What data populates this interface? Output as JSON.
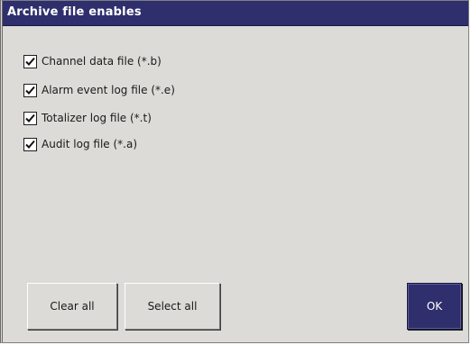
{
  "dialog": {
    "title": "Archive file enables"
  },
  "options": [
    {
      "label": "Channel data file (*.b)",
      "checked": true
    },
    {
      "label": "Alarm event log file (*.e)",
      "checked": true
    },
    {
      "label": "Totalizer log file (*.t)",
      "checked": true
    },
    {
      "label": "Audit log file (*.a)",
      "checked": true
    }
  ],
  "buttons": {
    "clear_all": "Clear all",
    "select_all": "Select all",
    "ok": "OK"
  },
  "colors": {
    "title_bar": "#2f2f6e",
    "dialog_background": "#dcdbd7",
    "ok_button": "#2f2f6e"
  },
  "icons": {
    "checkbox": "checkmark-icon"
  }
}
